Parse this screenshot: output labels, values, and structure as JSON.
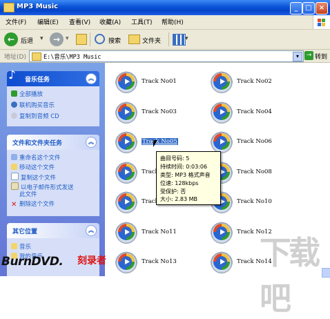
{
  "window": {
    "title": "MP3 Music"
  },
  "menu": [
    "文件(F)",
    "编辑(E)",
    "查看(V)",
    "收藏(A)",
    "工具(T)",
    "帮助(H)"
  ],
  "toolbar": {
    "back": "后退",
    "search": "搜索",
    "folders": "文件夹"
  },
  "address": {
    "label": "地址(D)",
    "path": "E:\\音乐\\MP3 Music",
    "go": "转到"
  },
  "sidebar": {
    "music_tasks": {
      "title": "音乐任务",
      "items": [
        "全部播放",
        "联机购买音乐",
        "复制到音频 CD"
      ]
    },
    "file_tasks": {
      "title": "文件和文件夹任务",
      "items": [
        "重命名这个文件",
        "移动这个文件",
        "复制这个文件",
        "以电子邮件形式发送",
        "此文件",
        "删除这个文件"
      ]
    },
    "other_places": {
      "title": "其它位置",
      "items": [
        "音乐",
        "我的音乐"
      ]
    }
  },
  "tracks": [
    "Track No01",
    "Track No02",
    "Track No03",
    "Track No04",
    "Track No05",
    "Track No06",
    "Track No07",
    "Track No08",
    "Track No09",
    "Track No10",
    "Track No11",
    "Track No12",
    "Track No13",
    "Track No14"
  ],
  "selected_track": "Track No05",
  "tooltip": [
    "曲目号码: 5",
    "持续时间: 0:03:06",
    "类型: MP3 格式声音",
    "位速: 128kbps",
    "受保护: 否",
    "大小: 2.83 MB"
  ],
  "watermark": {
    "brand": "BurnDVD.",
    "brand_cn": "刻录者",
    "right": "下载吧"
  }
}
